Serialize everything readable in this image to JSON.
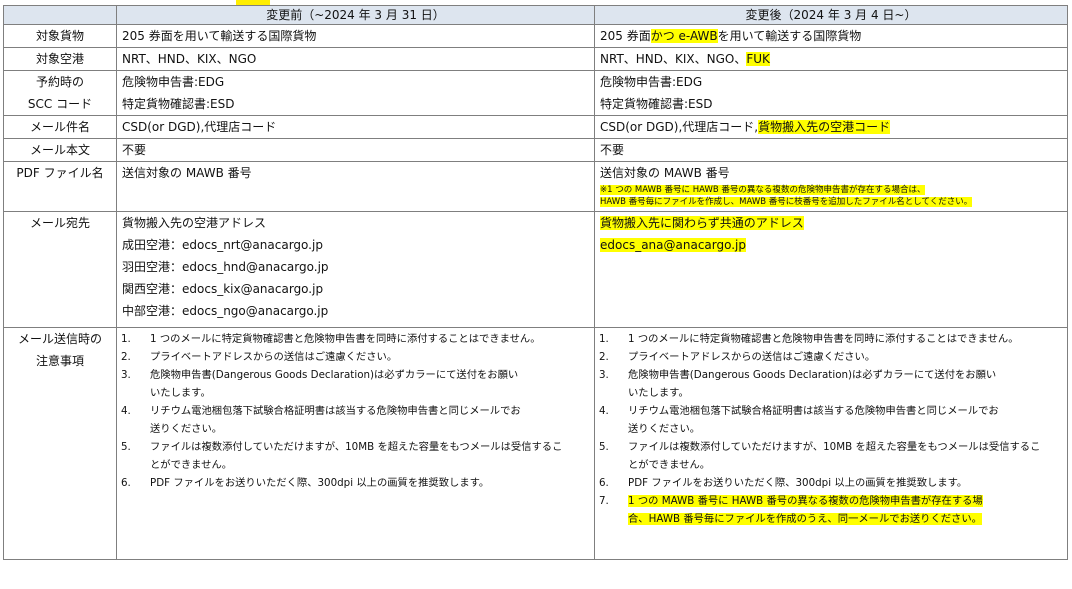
{
  "header": {
    "before": "変更前（~2024 年 3 月 31 日）",
    "after": "変更後（2024 年 3 月 4 日~）"
  },
  "rows": {
    "cargo": {
      "label": "対象貨物",
      "before": "205 券面を用いて輸送する国際貨物",
      "after_a": "205 券面",
      "after_hl": "かつ e-AWB",
      "after_b": "を用いて輸送する国際貨物"
    },
    "airport": {
      "label": "対象空港",
      "before": "NRT、HND、KIX、NGO",
      "after_a": "NRT、HND、KIX、NGO、",
      "after_hl": "FUK"
    },
    "scc": {
      "label_1": "予約時の",
      "label_2": "SCC コード",
      "line1": "危険物申告書:EDG",
      "line2": "特定貨物確認書:ESD"
    },
    "subject": {
      "label": "メール件名",
      "before": "CSD(or DGD),代理店コード",
      "after_a": "CSD(or DGD),代理店コード,",
      "after_hl": "貨物搬入先の空港コード"
    },
    "body": {
      "label": "メール本文",
      "before": "不要",
      "after": "不要"
    },
    "pdf": {
      "label": "PDF ファイル名",
      "before": "送信対象の MAWB 番号",
      "after": "送信対象の MAWB 番号",
      "note_1": "※1 つの MAWB 番号に HAWB 番号の異なる複数の危険物申告書が存在する場合は、",
      "note_2": "HAWB 番号毎にファイルを作成し、MAWB 番号に枝番号を追加したファイル名としてください。"
    },
    "address": {
      "label": "メール宛先",
      "before_title": "貨物搬入先の空港アドレス",
      "narita": "成田空港：edocs_nrt@anacargo.jp",
      "haneda": "羽田空港：edocs_hnd@anacargo.jp",
      "kansai": "関西空港：edocs_kix@anacargo.jp",
      "chubu": "中部空港：edocs_ngo@anacargo.jp",
      "after_title": "貨物搬入先に関わらず共通のアドレス",
      "after_email": "edocs_ana@anacargo.jp"
    },
    "notes": {
      "label_1": "メール送信時の",
      "label_2": "注意事項",
      "items": [
        {
          "num": "1.",
          "l1": "1 つのメールに特定貨物確認書と危険物申告書を同時に添付することはできません。"
        },
        {
          "num": "2.",
          "l1": "プライベートアドレスからの送信はご遠慮ください。"
        },
        {
          "num": "3.",
          "l1": "危険物申告書(Dangerous Goods Declaration)は必ずカラーにて送付をお願い",
          "l2": "いたします。"
        },
        {
          "num": "4.",
          "l1": "リチウム電池梱包落下試験合格証明書は該当する危険物申告書と同じメールでお",
          "l2": "送りください。"
        },
        {
          "num": "5.",
          "l1": "ファイルは複数添付していただけますが、10MB を超えた容量をもつメールは受信するこ",
          "l2": "とができません。"
        },
        {
          "num": "6.",
          "l1": "PDF ファイルをお送りいただく際、300dpi 以上の画質を推奨致します。"
        }
      ],
      "item7": {
        "num": "7.",
        "l1": "1 つの MAWB 番号に HAWB 番号の異なる複数の危険物申告書が存在する場",
        "l2": "合、HAWB 番号毎にファイルを作成のうえ、同一メールでお送りください。"
      }
    }
  },
  "colors": {
    "header_bg": "#dde5ef",
    "highlight": "#ffff00",
    "border": "#7f7f7f"
  }
}
